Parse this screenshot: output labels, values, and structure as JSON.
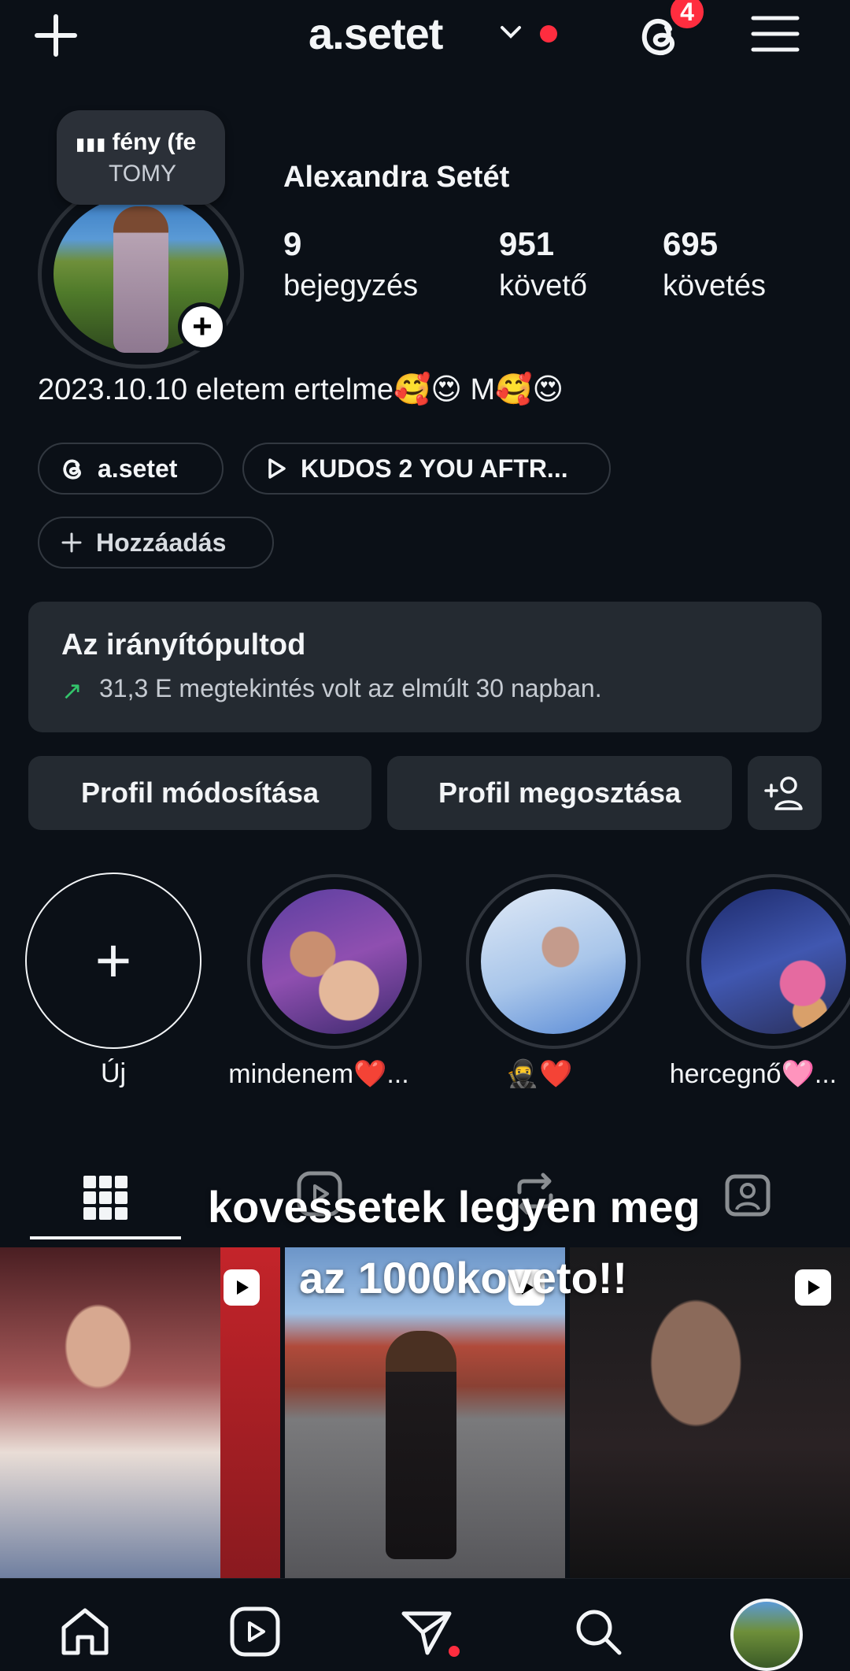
{
  "header": {
    "username": "a.setet",
    "notification_count": "4"
  },
  "profile": {
    "music_note": {
      "title": "fény (fe",
      "artist": "TOMY"
    },
    "display_name": "Alexandra Setét",
    "stats": {
      "posts": {
        "value": "9",
        "label": "bejegyzés"
      },
      "followers": {
        "value": "951",
        "label": "követő"
      },
      "following": {
        "value": "695",
        "label": "követés"
      }
    },
    "bio": "2023.10.10 eletem ertelme🥰😍 M🥰😍",
    "links": {
      "threads": "a.setet",
      "music": "KUDOS 2 YOU AFTR...",
      "add": "Hozzáadás"
    }
  },
  "dashboard": {
    "title": "Az irányítópultod",
    "subtitle": "31,3 E megtekintés volt az elmúlt 30 napban."
  },
  "actions": {
    "edit": "Profil módosítása",
    "share": "Profil megosztása"
  },
  "highlights": [
    {
      "label": "Új"
    },
    {
      "label": "mindenem❤️..."
    },
    {
      "label": "🥷❤️"
    },
    {
      "label": "hercegnő🩷..."
    }
  ],
  "overlay_caption": {
    "line1": "kovessetek legyen meg",
    "line2": "az 1000koveto!!"
  },
  "colors": {
    "background": "#0b1017",
    "card": "#242a31",
    "accent_red": "#ff2d3f",
    "trend_green": "#33c46b"
  },
  "icons": {
    "new_post": "plus-icon",
    "threads": "threads-icon",
    "menu": "hamburger-icon",
    "discover_people": "add-person-icon",
    "grid_tab": "grid-icon",
    "reels_tab": "reels-icon",
    "reposts_tab": "repost-icon",
    "tagged_tab": "tagged-icon",
    "nav": [
      "home-icon",
      "reels-icon",
      "direct-icon",
      "search-icon",
      "profile-avatar"
    ]
  }
}
